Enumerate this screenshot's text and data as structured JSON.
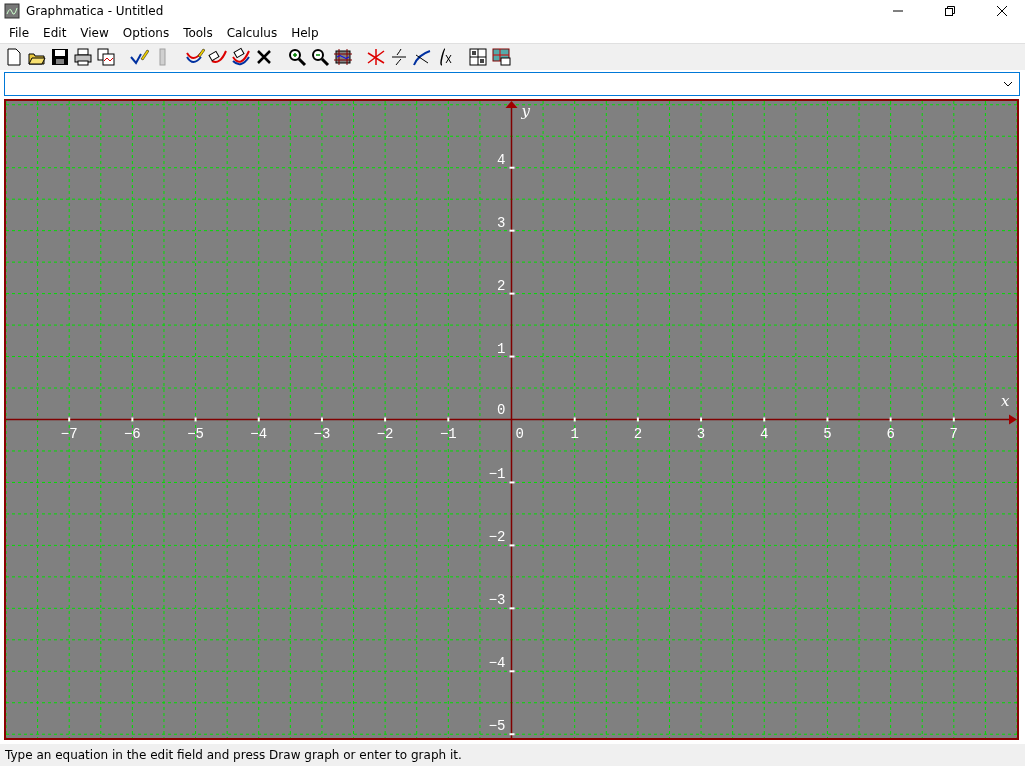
{
  "window": {
    "title": "Graphmatica - Untitled"
  },
  "menu": [
    "File",
    "Edit",
    "View",
    "Options",
    "Tools",
    "Calculus",
    "Help"
  ],
  "graph": {
    "origin_label": "0",
    "chart_data": {
      "type": "line",
      "grid": true,
      "xlabel": "x",
      "ylabel": "y",
      "xlim": [
        -8,
        8
      ],
      "ylim": [
        -5.06,
        5.06
      ],
      "xticks": [
        {
          "value": -7,
          "label": "−7"
        },
        {
          "value": -6,
          "label": "−6"
        },
        {
          "value": -5,
          "label": "−5"
        },
        {
          "value": -4,
          "label": "−4"
        },
        {
          "value": -3,
          "label": "−3"
        },
        {
          "value": -2,
          "label": "−2"
        },
        {
          "value": -1,
          "label": "−1"
        },
        {
          "value": 1,
          "label": "1"
        },
        {
          "value": 2,
          "label": "2"
        },
        {
          "value": 3,
          "label": "3"
        },
        {
          "value": 4,
          "label": "4"
        },
        {
          "value": 5,
          "label": "5"
        },
        {
          "value": 6,
          "label": "6"
        },
        {
          "value": 7,
          "label": "7"
        }
      ],
      "yticks": [
        {
          "value": 4,
          "label": "4"
        },
        {
          "value": 3,
          "label": "3"
        },
        {
          "value": 2,
          "label": "2"
        },
        {
          "value": 1,
          "label": "1"
        },
        {
          "value": 0,
          "label": "0"
        },
        {
          "value": -1,
          "label": "−1"
        },
        {
          "value": -2,
          "label": "−2"
        },
        {
          "value": -3,
          "label": "−3"
        },
        {
          "value": -4,
          "label": "−4"
        },
        {
          "value": -5,
          "label": "−5"
        }
      ]
    }
  },
  "status_bar": {
    "text": "Type an equation in the edit field and press Draw graph or enter to graph it."
  }
}
